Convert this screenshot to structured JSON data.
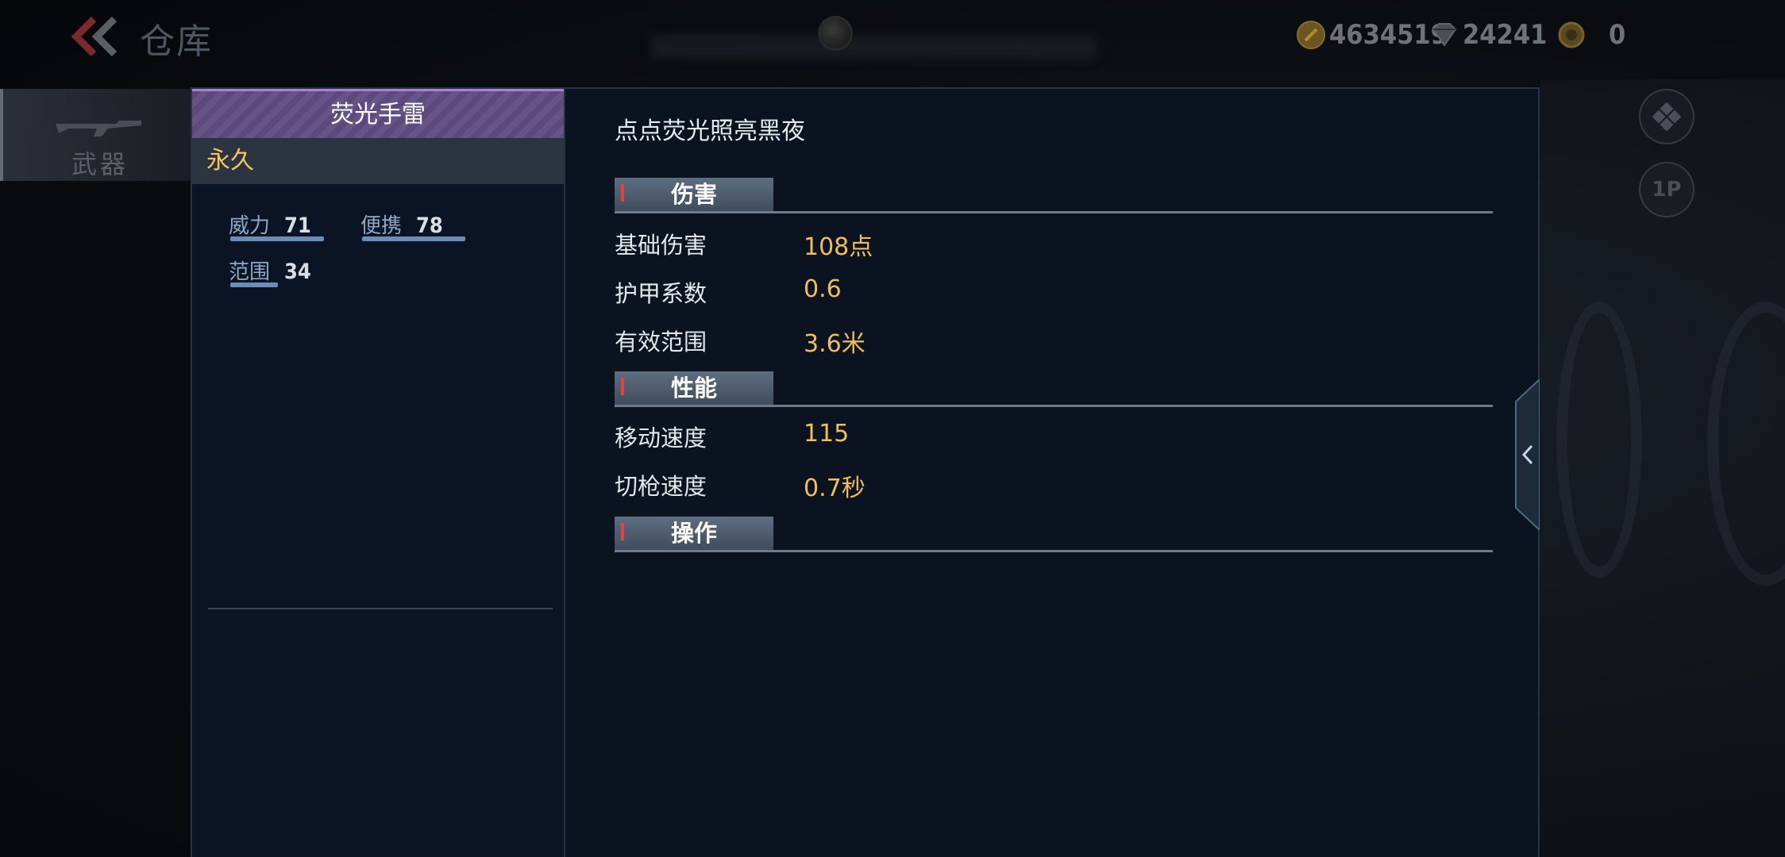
{
  "header": {
    "title": "仓库",
    "currencies": [
      {
        "icon": "gold-coin-icon",
        "value": "4634519"
      },
      {
        "icon": "diamond-icon",
        "value": "24241"
      },
      {
        "icon": "token-icon",
        "value": "0"
      }
    ]
  },
  "sidebar": {
    "tabs": [
      {
        "label": "武器",
        "icon": "rifle-icon"
      }
    ]
  },
  "side_buttons": [
    {
      "icon": "diamond-grid-icon"
    },
    {
      "label": "1P"
    }
  ],
  "item": {
    "name": "荧光手雷",
    "duration": "永久",
    "attributes": [
      {
        "name": "威力",
        "value": "71"
      },
      {
        "name": "便携",
        "value": "78"
      },
      {
        "name": "范围",
        "value": "34"
      }
    ],
    "description": "点点荧光照亮黑夜"
  },
  "sections": [
    {
      "title": "伤害",
      "stats": [
        {
          "name": "基础伤害",
          "value": "108点"
        },
        {
          "name": "护甲系数",
          "value": "0.6"
        },
        {
          "name": "有效范围",
          "value": "3.6米"
        }
      ]
    },
    {
      "title": "性能",
      "stats": [
        {
          "name": "移动速度",
          "value": "115"
        },
        {
          "name": "切枪速度",
          "value": "0.7秒"
        }
      ]
    },
    {
      "title": "操作",
      "stats": []
    }
  ],
  "colors": {
    "accent_purple": "#7f6aa0",
    "stat_value": "#f0bf56",
    "duration": "#f2c85a",
    "panel_bg": "#0b1321"
  }
}
